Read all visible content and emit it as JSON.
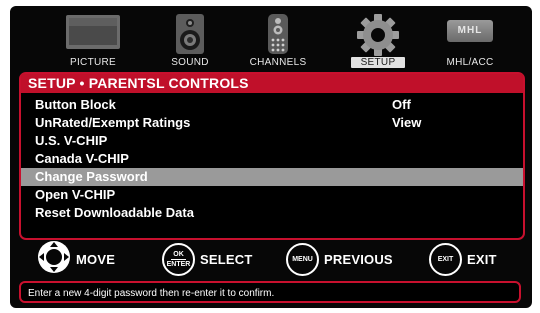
{
  "tabs": [
    {
      "label": "PICTURE",
      "icon": "tv-icon",
      "selected": false
    },
    {
      "label": "SOUND",
      "icon": "speaker-icon",
      "selected": false
    },
    {
      "label": "CHANNELS",
      "icon": "remote-icon",
      "selected": false
    },
    {
      "label": "SETUP",
      "icon": "gear-icon",
      "selected": true
    },
    {
      "label": "MHL/ACC",
      "icon": "mhl-icon",
      "selected": false
    }
  ],
  "mhl_logo_text": "MHL",
  "panel": {
    "title": "SETUP • PARENTSL CONTROLS",
    "items": [
      {
        "label": "Button Block",
        "value": "Off"
      },
      {
        "label": "UnRated/Exempt Ratings",
        "value": "View"
      },
      {
        "label": "U.S. V-CHIP",
        "value": ""
      },
      {
        "label": "Canada V-CHIP",
        "value": ""
      },
      {
        "label": "Change Password",
        "value": "",
        "selected": true
      },
      {
        "label": "Open V-CHIP",
        "value": ""
      },
      {
        "label": "Reset Downloadable Data",
        "value": ""
      }
    ]
  },
  "legend": {
    "move": {
      "label": "MOVE",
      "icon": "dpad-icon"
    },
    "select": {
      "label": "SELECT",
      "key_top": "OK",
      "key_bottom": "ENTER"
    },
    "previous": {
      "label": "PREVIOUS",
      "key": "MENU"
    },
    "exit": {
      "label": "EXIT",
      "key": "EXIT"
    }
  },
  "help_text": "Enter a new 4-digit password then re-enter it to confirm.",
  "colors": {
    "accent": "#c0102a",
    "selected_row": "#9a9a9a",
    "background": "#070707"
  }
}
